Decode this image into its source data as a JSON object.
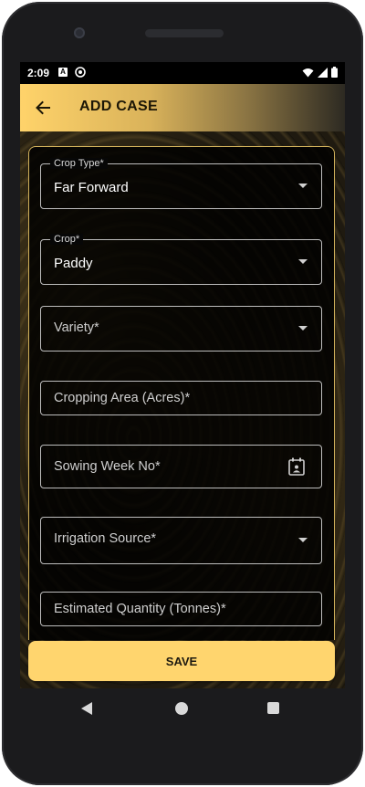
{
  "status_bar": {
    "time": "2:09",
    "notification_a": "A",
    "icons": [
      "wifi-icon",
      "signal-icon",
      "battery-icon"
    ]
  },
  "app_bar": {
    "title": "ADD CASE",
    "back_icon": "arrow-left-icon"
  },
  "form": {
    "fields": [
      {
        "label": "Crop Type*",
        "value": "Far Forward",
        "type": "dropdown"
      },
      {
        "label": "Crop*",
        "value": "Paddy",
        "type": "dropdown"
      },
      {
        "placeholder": "Variety*",
        "type": "dropdown"
      },
      {
        "placeholder": "Cropping Area (Acres)*",
        "type": "text"
      },
      {
        "placeholder": "Sowing Week No*",
        "type": "date"
      },
      {
        "placeholder": "Irrigation Source*",
        "type": "dropdown"
      },
      {
        "placeholder": "Estimated Quantity (Tonnes)*",
        "type": "text"
      }
    ]
  },
  "save_button": {
    "label": "SAVE"
  },
  "colors": {
    "accent": "#ffd56e",
    "card_border": "#d3b35c",
    "field_border": "#bdbdbd"
  }
}
